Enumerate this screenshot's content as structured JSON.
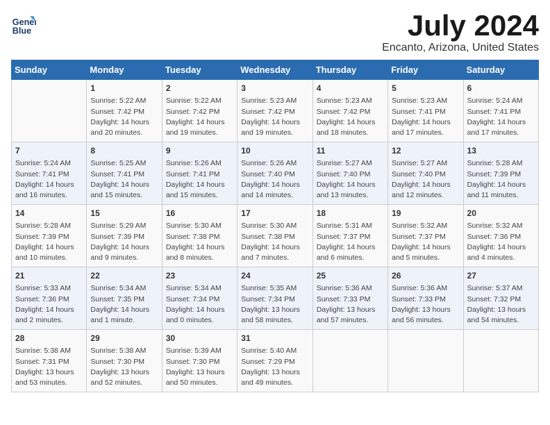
{
  "logo": {
    "line1": "General",
    "line2": "Blue"
  },
  "title": "July 2024",
  "subtitle": "Encanto, Arizona, United States",
  "headers": [
    "Sunday",
    "Monday",
    "Tuesday",
    "Wednesday",
    "Thursday",
    "Friday",
    "Saturday"
  ],
  "rows": [
    [
      {
        "day": "",
        "lines": []
      },
      {
        "day": "1",
        "lines": [
          "Sunrise: 5:22 AM",
          "Sunset: 7:42 PM",
          "Daylight: 14 hours",
          "and 20 minutes."
        ]
      },
      {
        "day": "2",
        "lines": [
          "Sunrise: 5:22 AM",
          "Sunset: 7:42 PM",
          "Daylight: 14 hours",
          "and 19 minutes."
        ]
      },
      {
        "day": "3",
        "lines": [
          "Sunrise: 5:23 AM",
          "Sunset: 7:42 PM",
          "Daylight: 14 hours",
          "and 19 minutes."
        ]
      },
      {
        "day": "4",
        "lines": [
          "Sunrise: 5:23 AM",
          "Sunset: 7:42 PM",
          "Daylight: 14 hours",
          "and 18 minutes."
        ]
      },
      {
        "day": "5",
        "lines": [
          "Sunrise: 5:23 AM",
          "Sunset: 7:41 PM",
          "Daylight: 14 hours",
          "and 17 minutes."
        ]
      },
      {
        "day": "6",
        "lines": [
          "Sunrise: 5:24 AM",
          "Sunset: 7:41 PM",
          "Daylight: 14 hours",
          "and 17 minutes."
        ]
      }
    ],
    [
      {
        "day": "7",
        "lines": [
          "Sunrise: 5:24 AM",
          "Sunset: 7:41 PM",
          "Daylight: 14 hours",
          "and 16 minutes."
        ]
      },
      {
        "day": "8",
        "lines": [
          "Sunrise: 5:25 AM",
          "Sunset: 7:41 PM",
          "Daylight: 14 hours",
          "and 15 minutes."
        ]
      },
      {
        "day": "9",
        "lines": [
          "Sunrise: 5:26 AM",
          "Sunset: 7:41 PM",
          "Daylight: 14 hours",
          "and 15 minutes."
        ]
      },
      {
        "day": "10",
        "lines": [
          "Sunrise: 5:26 AM",
          "Sunset: 7:40 PM",
          "Daylight: 14 hours",
          "and 14 minutes."
        ]
      },
      {
        "day": "11",
        "lines": [
          "Sunrise: 5:27 AM",
          "Sunset: 7:40 PM",
          "Daylight: 14 hours",
          "and 13 minutes."
        ]
      },
      {
        "day": "12",
        "lines": [
          "Sunrise: 5:27 AM",
          "Sunset: 7:40 PM",
          "Daylight: 14 hours",
          "and 12 minutes."
        ]
      },
      {
        "day": "13",
        "lines": [
          "Sunrise: 5:28 AM",
          "Sunset: 7:39 PM",
          "Daylight: 14 hours",
          "and 11 minutes."
        ]
      }
    ],
    [
      {
        "day": "14",
        "lines": [
          "Sunrise: 5:28 AM",
          "Sunset: 7:39 PM",
          "Daylight: 14 hours",
          "and 10 minutes."
        ]
      },
      {
        "day": "15",
        "lines": [
          "Sunrise: 5:29 AM",
          "Sunset: 7:39 PM",
          "Daylight: 14 hours",
          "and 9 minutes."
        ]
      },
      {
        "day": "16",
        "lines": [
          "Sunrise: 5:30 AM",
          "Sunset: 7:38 PM",
          "Daylight: 14 hours",
          "and 8 minutes."
        ]
      },
      {
        "day": "17",
        "lines": [
          "Sunrise: 5:30 AM",
          "Sunset: 7:38 PM",
          "Daylight: 14 hours",
          "and 7 minutes."
        ]
      },
      {
        "day": "18",
        "lines": [
          "Sunrise: 5:31 AM",
          "Sunset: 7:37 PM",
          "Daylight: 14 hours",
          "and 6 minutes."
        ]
      },
      {
        "day": "19",
        "lines": [
          "Sunrise: 5:32 AM",
          "Sunset: 7:37 PM",
          "Daylight: 14 hours",
          "and 5 minutes."
        ]
      },
      {
        "day": "20",
        "lines": [
          "Sunrise: 5:32 AM",
          "Sunset: 7:36 PM",
          "Daylight: 14 hours",
          "and 4 minutes."
        ]
      }
    ],
    [
      {
        "day": "21",
        "lines": [
          "Sunrise: 5:33 AM",
          "Sunset: 7:36 PM",
          "Daylight: 14 hours",
          "and 2 minutes."
        ]
      },
      {
        "day": "22",
        "lines": [
          "Sunrise: 5:34 AM",
          "Sunset: 7:35 PM",
          "Daylight: 14 hours",
          "and 1 minute."
        ]
      },
      {
        "day": "23",
        "lines": [
          "Sunrise: 5:34 AM",
          "Sunset: 7:34 PM",
          "Daylight: 14 hours",
          "and 0 minutes."
        ]
      },
      {
        "day": "24",
        "lines": [
          "Sunrise: 5:35 AM",
          "Sunset: 7:34 PM",
          "Daylight: 13 hours",
          "and 58 minutes."
        ]
      },
      {
        "day": "25",
        "lines": [
          "Sunrise: 5:36 AM",
          "Sunset: 7:33 PM",
          "Daylight: 13 hours",
          "and 57 minutes."
        ]
      },
      {
        "day": "26",
        "lines": [
          "Sunrise: 5:36 AM",
          "Sunset: 7:33 PM",
          "Daylight: 13 hours",
          "and 56 minutes."
        ]
      },
      {
        "day": "27",
        "lines": [
          "Sunrise: 5:37 AM",
          "Sunset: 7:32 PM",
          "Daylight: 13 hours",
          "and 54 minutes."
        ]
      }
    ],
    [
      {
        "day": "28",
        "lines": [
          "Sunrise: 5:38 AM",
          "Sunset: 7:31 PM",
          "Daylight: 13 hours",
          "and 53 minutes."
        ]
      },
      {
        "day": "29",
        "lines": [
          "Sunrise: 5:38 AM",
          "Sunset: 7:30 PM",
          "Daylight: 13 hours",
          "and 52 minutes."
        ]
      },
      {
        "day": "30",
        "lines": [
          "Sunrise: 5:39 AM",
          "Sunset: 7:30 PM",
          "Daylight: 13 hours",
          "and 50 minutes."
        ]
      },
      {
        "day": "31",
        "lines": [
          "Sunrise: 5:40 AM",
          "Sunset: 7:29 PM",
          "Daylight: 13 hours",
          "and 49 minutes."
        ]
      },
      {
        "day": "",
        "lines": []
      },
      {
        "day": "",
        "lines": []
      },
      {
        "day": "",
        "lines": []
      }
    ]
  ]
}
